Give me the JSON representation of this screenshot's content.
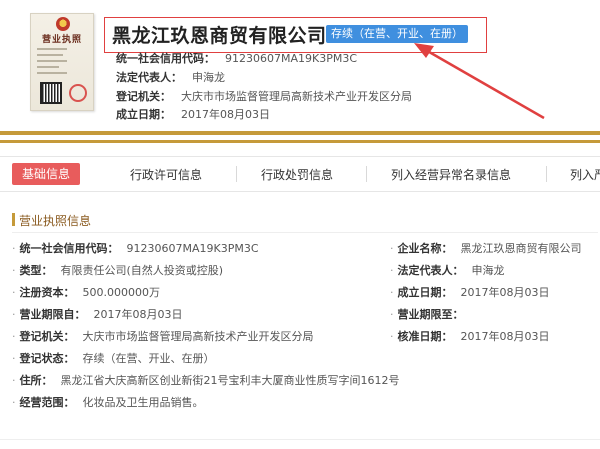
{
  "header": {
    "license_image": {
      "title": "营业执照"
    },
    "company_name": "黑龙江玖恩商贸有限公司",
    "status_badge": "存续（在营、开业、在册）",
    "fields": [
      {
        "label": "统一社会信用代码：",
        "value": "91230607MA19K3PM3C"
      },
      {
        "label": "法定代表人：",
        "value": "申海龙"
      },
      {
        "label": "登记机关：",
        "value": "大庆市市场监督管理局高新技术产业开发区分局"
      },
      {
        "label": "成立日期：",
        "value": "2017年08月03日"
      }
    ]
  },
  "colors": {
    "accent_gold": "#c59a3a",
    "active_tab": "#e85c5c",
    "badge_blue": "#3f8fdf",
    "highlight_red": "#e04040"
  },
  "tabs": [
    {
      "label": "基础信息",
      "active": true
    },
    {
      "label": "行政许可信息",
      "active": false
    },
    {
      "label": "行政处罚信息",
      "active": false
    },
    {
      "label": "列入经营异常名录信息",
      "active": false
    },
    {
      "label": "列入严",
      "active": false
    }
  ],
  "section": {
    "title": "营业执照信息",
    "left": [
      {
        "label": "统一社会信用代码：",
        "value": "91230607MA19K3PM3C"
      },
      {
        "label": "类型：",
        "value": "有限责任公司(自然人投资或控股)"
      },
      {
        "label": "注册资本：",
        "value": "500.000000万"
      },
      {
        "label": "营业期限自：",
        "value": "2017年08月03日"
      },
      {
        "label": "登记机关：",
        "value": "大庆市市场监督管理局高新技术产业开发区分局"
      },
      {
        "label": "登记状态：",
        "value": "存续（在营、开业、在册）"
      }
    ],
    "right": [
      {
        "label": "企业名称：",
        "value": "黑龙江玖恩商贸有限公司"
      },
      {
        "label": "法定代表人：",
        "value": "申海龙"
      },
      {
        "label": "成立日期：",
        "value": "2017年08月03日"
      },
      {
        "label": "营业期限至：",
        "value": ""
      },
      {
        "label": "核准日期：",
        "value": "2017年08月03日"
      }
    ],
    "address": {
      "label": "住所：",
      "value": "黑龙江省大庆高新区创业新街21号宝利丰大厦商业性质写字间1612号"
    },
    "scope": {
      "label": "经营范围：",
      "value": "化妆品及卫生用品销售。"
    }
  }
}
